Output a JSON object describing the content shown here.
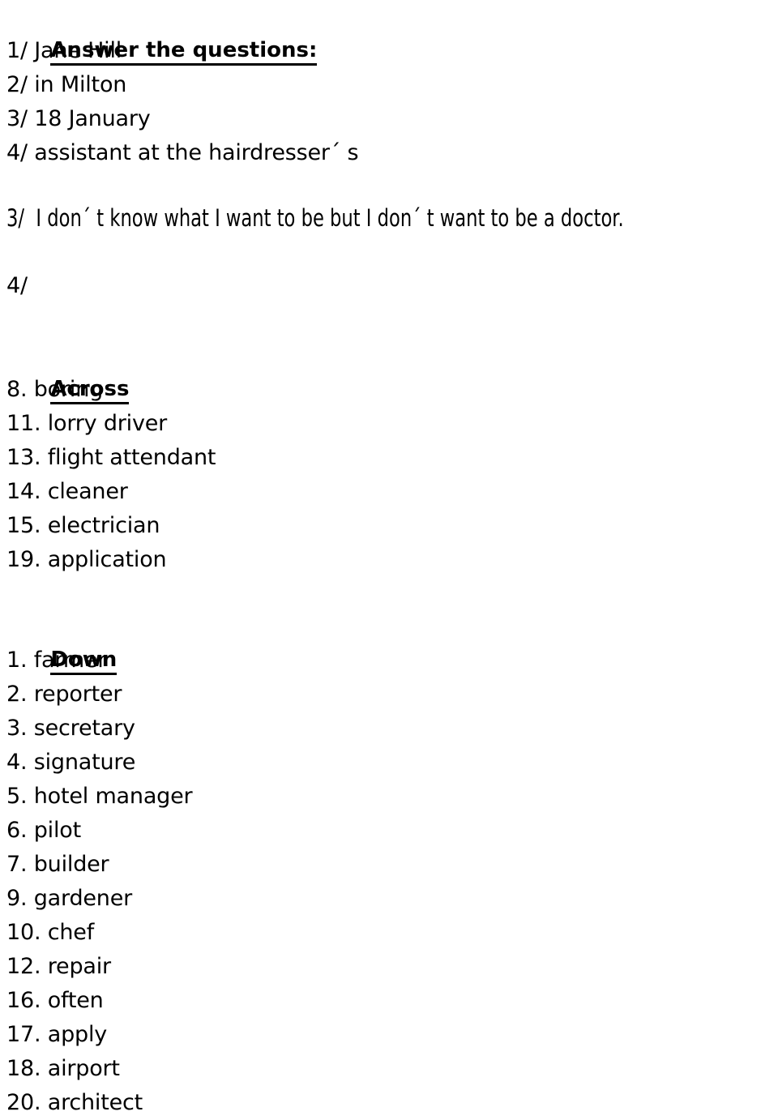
{
  "document": {
    "background_color": "#ffffff",
    "text_color": "#000000",
    "title": "Answer the questions:",
    "answers": [
      "1/ Jane Hill",
      "2/ in Milton",
      "3/ 18 January",
      "4/ assistant at the hairdresser´ s"
    ],
    "sentence_answers": [
      "3/  I don´ t know what I want to be but I don´ t want to be a doctor.",
      "4/"
    ],
    "across": {
      "heading": "Across",
      "items": [
        "8. boring",
        "11. lorry driver",
        "13. flight attendant",
        "14. cleaner",
        "15. electrician",
        "19. application"
      ]
    },
    "down": {
      "heading": "Down",
      "items": [
        "1. farmer",
        "2. reporter",
        "3. secretary",
        "4. signature",
        "5. hotel manager",
        "6. pilot",
        "7. builder",
        "9. gardener",
        "10. chef",
        "12. repair",
        "16. often",
        "17. apply",
        "18. airport",
        "20. architect"
      ]
    }
  }
}
